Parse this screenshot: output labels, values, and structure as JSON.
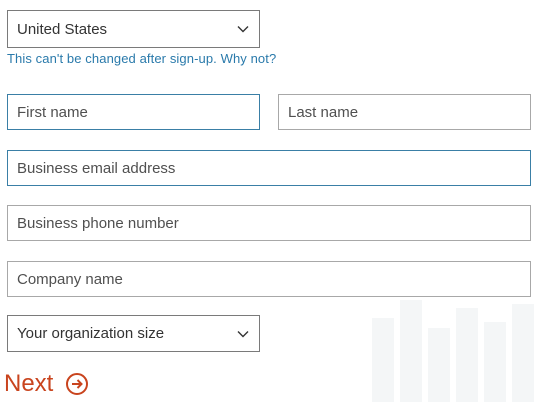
{
  "form": {
    "country": {
      "selected": "United States"
    },
    "country_hint": "This can't be changed after sign-up. Why not?",
    "first_name": {
      "placeholder": "First name"
    },
    "last_name": {
      "placeholder": "Last name"
    },
    "business_email": {
      "placeholder": "Business email address"
    },
    "business_phone": {
      "placeholder": "Business phone number"
    },
    "company_name": {
      "placeholder": "Company name"
    },
    "org_size": {
      "selected": "Your organization size"
    },
    "next_label": "Next"
  },
  "colors": {
    "accent": "#c9441e",
    "link": "#2a7aab",
    "focus_border": "#3a7fa6"
  },
  "icons": {
    "select_chevron": "chevron-down-icon",
    "next_arrow": "arrow-circle-right-icon"
  }
}
